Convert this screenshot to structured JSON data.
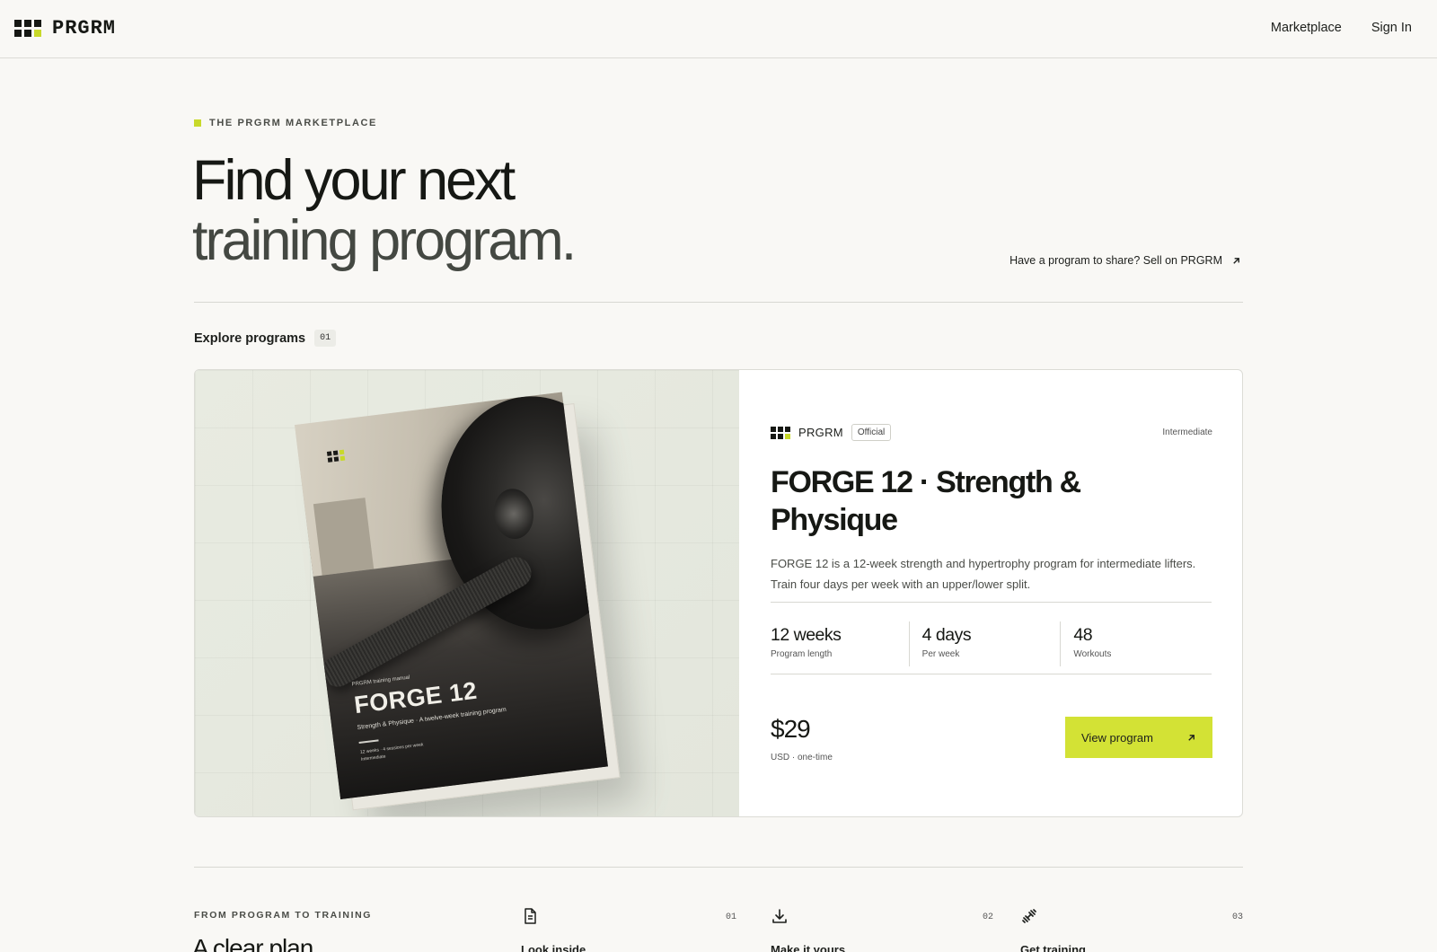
{
  "brand": {
    "name": "PRGRM"
  },
  "nav": {
    "marketplace": "Marketplace",
    "sign_in": "Sign In"
  },
  "hero": {
    "eyebrow": "THE PRGRM MARKETPLACE",
    "title_line1": "Find your next",
    "title_line2": "training program.",
    "sell_link": "Have a program to share? Sell on PRGRM"
  },
  "explore": {
    "label": "Explore programs",
    "count": "01"
  },
  "program": {
    "cover": {
      "kicker": "PRGRM training manual",
      "title": "FORGE 12",
      "subtitle": "Strength & Physique · A twelve-week training program",
      "meta_line1": "12 weeks · 4 sessions per week",
      "meta_line2": "Intermediate"
    },
    "publisher": "PRGRM",
    "badge": "Official",
    "level": "Intermediate",
    "title": "FORGE 12 · Strength & Physique",
    "description": "FORGE 12 is a 12-week strength and hypertrophy program for intermediate lifters. Train four days per week with an upper/lower split.",
    "stats": [
      {
        "value": "12 weeks",
        "label": "Program length"
      },
      {
        "value": "4 days",
        "label": "Per week"
      },
      {
        "value": "48",
        "label": "Workouts"
      }
    ],
    "price": "$29",
    "price_note": "USD · one-time",
    "cta": "View program"
  },
  "flow": {
    "eyebrow": "FROM PROGRAM TO TRAINING",
    "title": "A clear plan",
    "steps": [
      {
        "number": "01",
        "title": "Look inside",
        "icon": "document-icon"
      },
      {
        "number": "02",
        "title": "Make it yours",
        "icon": "download-icon"
      },
      {
        "number": "03",
        "title": "Get training",
        "icon": "dumbbell-icon"
      }
    ]
  },
  "colors": {
    "accent": "#d3e235",
    "background": "#f9f8f5",
    "text": "#161814"
  }
}
